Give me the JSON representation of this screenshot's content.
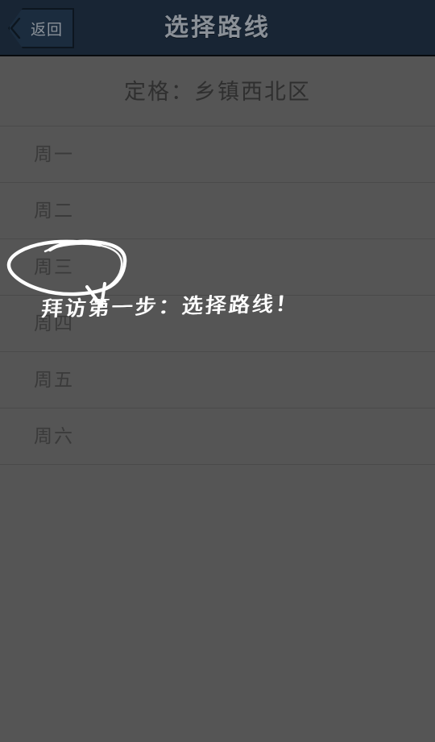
{
  "navbar": {
    "back_label": "返回",
    "back_icon": "chevron-left-icon",
    "title": "选择路线",
    "background_color": "#182534",
    "title_color": "#8a9097"
  },
  "section": {
    "header": "定格：乡镇西北区",
    "text_color": "#2f2f2f"
  },
  "list": {
    "rows": [
      {
        "label": "周一"
      },
      {
        "label": "周二"
      },
      {
        "label": "周三"
      },
      {
        "label": "周四"
      },
      {
        "label": "周五"
      },
      {
        "label": "周六"
      }
    ],
    "background_color": "#555555",
    "divider_color": "#4a4a4a",
    "text_color": "#3a3a3a"
  },
  "annotation": {
    "text": "拜访第一步：选择路线！",
    "highlight_target": "周三",
    "stroke_color": "#ffffff"
  }
}
